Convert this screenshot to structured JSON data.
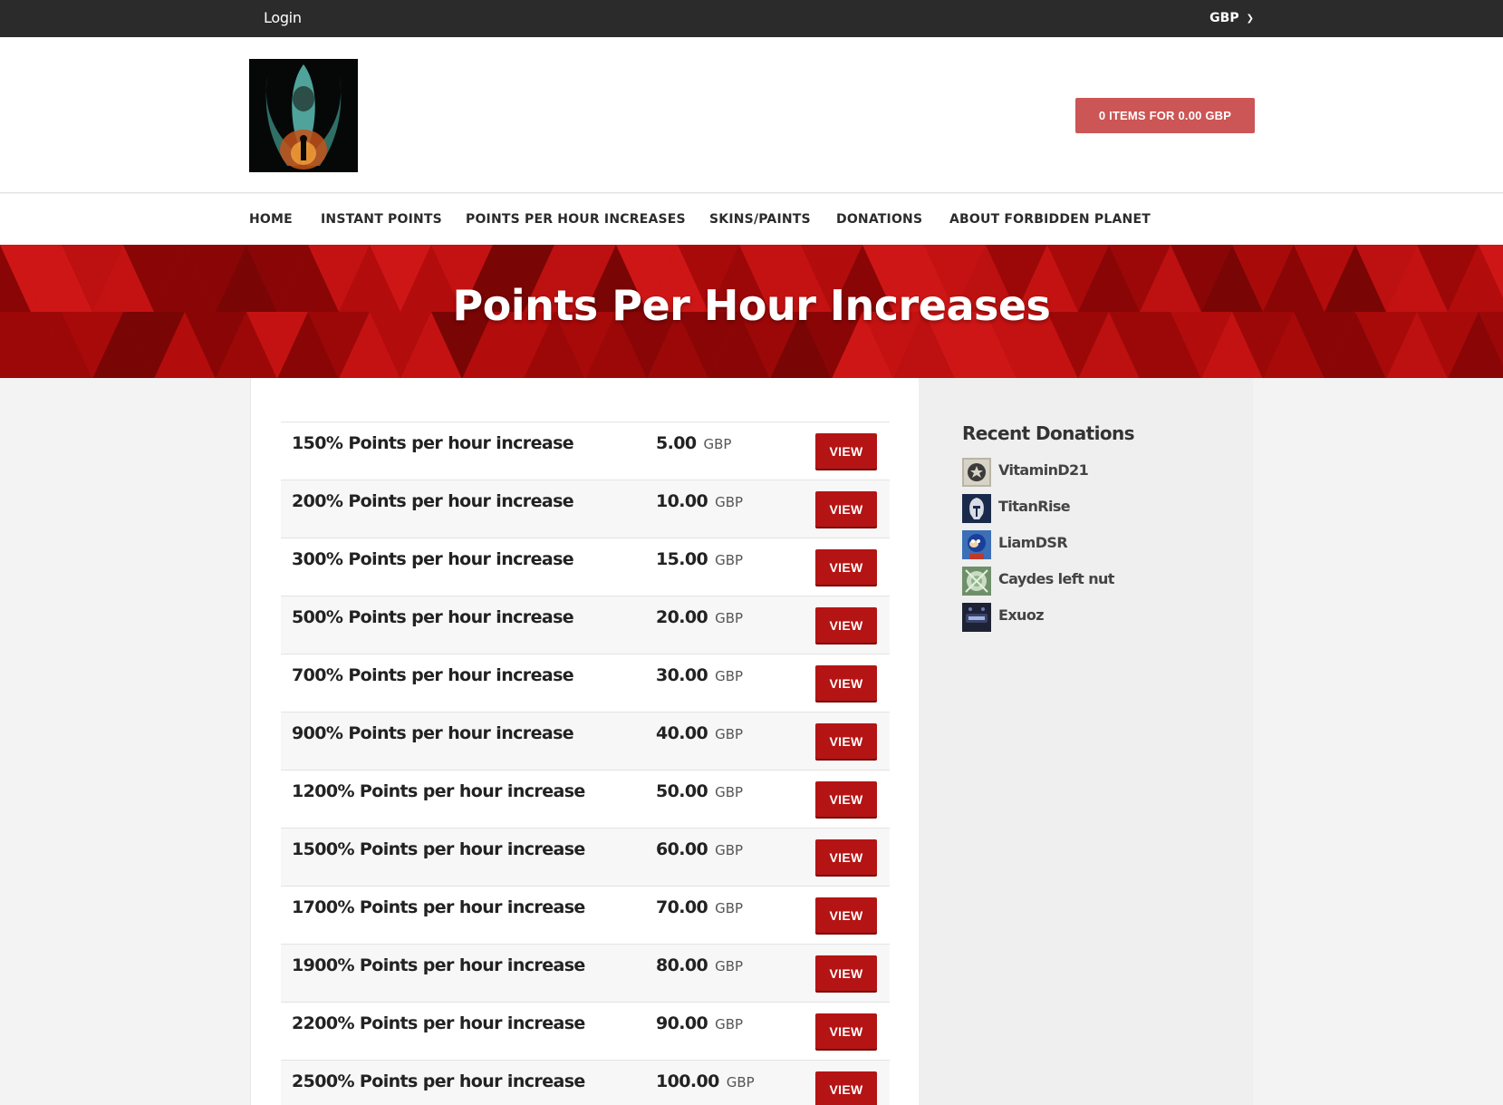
{
  "topbar": {
    "login": "Login",
    "currency": "GBP"
  },
  "header": {
    "cart_label": "0 ITEMS FOR 0.00 GBP"
  },
  "nav": {
    "items": [
      {
        "label": "HOME"
      },
      {
        "label": "INSTANT POINTS"
      },
      {
        "label": "POINTS PER HOUR INCREASES"
      },
      {
        "label": "SKINS/PAINTS"
      },
      {
        "label": "DONATIONS"
      },
      {
        "label": "ABOUT FORBIDDEN PLANET"
      }
    ]
  },
  "hero": {
    "title": "Points Per Hour Increases"
  },
  "products": [
    {
      "name": "150% Points per hour increase",
      "price": "5.00",
      "currency": "GBP",
      "button": "VIEW"
    },
    {
      "name": "200% Points per hour increase",
      "price": "10.00",
      "currency": "GBP",
      "button": "VIEW"
    },
    {
      "name": "300% Points per hour increase",
      "price": "15.00",
      "currency": "GBP",
      "button": "VIEW"
    },
    {
      "name": "500% Points per hour increase",
      "price": "20.00",
      "currency": "GBP",
      "button": "VIEW"
    },
    {
      "name": "700% Points per hour increase",
      "price": "30.00",
      "currency": "GBP",
      "button": "VIEW"
    },
    {
      "name": "900% Points per hour increase",
      "price": "40.00",
      "currency": "GBP",
      "button": "VIEW"
    },
    {
      "name": "1200% Points per hour increase",
      "price": "50.00",
      "currency": "GBP",
      "button": "VIEW"
    },
    {
      "name": "1500% Points per hour increase",
      "price": "60.00",
      "currency": "GBP",
      "button": "VIEW"
    },
    {
      "name": "1700% Points per hour increase",
      "price": "70.00",
      "currency": "GBP",
      "button": "VIEW"
    },
    {
      "name": "1900% Points per hour increase",
      "price": "80.00",
      "currency": "GBP",
      "button": "VIEW"
    },
    {
      "name": "2200% Points per hour increase",
      "price": "90.00",
      "currency": "GBP",
      "button": "VIEW"
    },
    {
      "name": "2500% Points per hour increase",
      "price": "100.00",
      "currency": "GBP",
      "button": "VIEW"
    }
  ],
  "sidebar": {
    "title": "Recent Donations",
    "donors": [
      {
        "name": "VitaminD21"
      },
      {
        "name": "TitanRise"
      },
      {
        "name": "LiamDSR"
      },
      {
        "name": "Caydes left nut"
      },
      {
        "name": "Exuoz"
      }
    ]
  }
}
